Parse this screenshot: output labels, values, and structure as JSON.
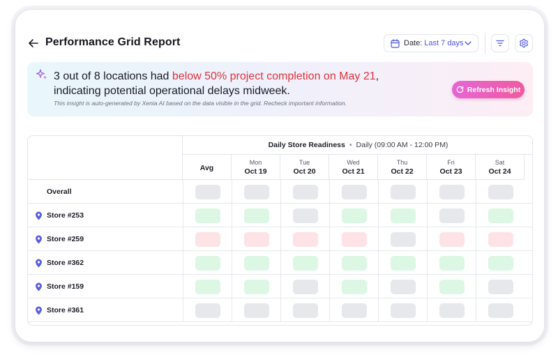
{
  "header": {
    "title": "Performance Grid Report",
    "date_prefix": "Date:",
    "date_value": "Last 7 days"
  },
  "insight": {
    "text_before": "3 out of 8 locations had ",
    "text_highlight": "below 50% project completion on May 21",
    "text_after_line1": ",",
    "text_line2": "indicating potential operational delays midweek.",
    "note": "This insight is auto-generated by Xenia AI based on the data visible in the grid. Recheck important information.",
    "refresh_label": "Refresh Insight",
    "highlight_color": "#e0323d"
  },
  "grid": {
    "group_title": "Daily Store Readiness",
    "group_separator": "•",
    "group_subtitle": "Daily (09:00 AM - 12:00 PM)",
    "avg_label": "Avg",
    "columns": [
      {
        "dow": "Mon",
        "date": "Oct 19"
      },
      {
        "dow": "Tue",
        "date": "Oct 20"
      },
      {
        "dow": "Wed",
        "date": "Oct 21"
      },
      {
        "dow": "Thu",
        "date": "Oct 22"
      },
      {
        "dow": "Fri",
        "date": "Oct 23"
      },
      {
        "dow": "Sat",
        "date": "Oct 24"
      }
    ],
    "rows": [
      {
        "label": "Overall",
        "pin": false,
        "cells": [
          "gray",
          "gray",
          "gray",
          "gray",
          "gray",
          "gray",
          "gray"
        ]
      },
      {
        "label": "Store #253",
        "pin": true,
        "cells": [
          "green",
          "green",
          "gray",
          "green",
          "green",
          "gray",
          "green"
        ]
      },
      {
        "label": "Store #259",
        "pin": true,
        "cells": [
          "red",
          "red",
          "red",
          "red",
          "gray",
          "red",
          "red"
        ]
      },
      {
        "label": "Store #362",
        "pin": true,
        "cells": [
          "green",
          "green",
          "green",
          "green",
          "green",
          "green",
          "green"
        ]
      },
      {
        "label": "Store #159",
        "pin": true,
        "cells": [
          "green",
          "green",
          "gray",
          "green",
          "gray",
          "green",
          "gray"
        ]
      },
      {
        "label": "Store #361",
        "pin": true,
        "cells": [
          "gray",
          "gray",
          "gray",
          "gray",
          "gray",
          "gray",
          "gray"
        ]
      }
    ]
  },
  "icons": {
    "back": "arrow-left-icon",
    "calendar": "calendar-icon",
    "chevron": "chevron-down-icon",
    "filter": "filter-icon",
    "settings": "gear-icon",
    "sparkle": "sparkle-icon",
    "refresh": "refresh-icon",
    "pin": "location-pin-icon"
  },
  "colors": {
    "accent": "#4a55d9",
    "pin": "#5b5fe0",
    "status_green": "#dcf7e4",
    "status_red": "#fde3e5",
    "status_gray": "#e6e8ec"
  }
}
